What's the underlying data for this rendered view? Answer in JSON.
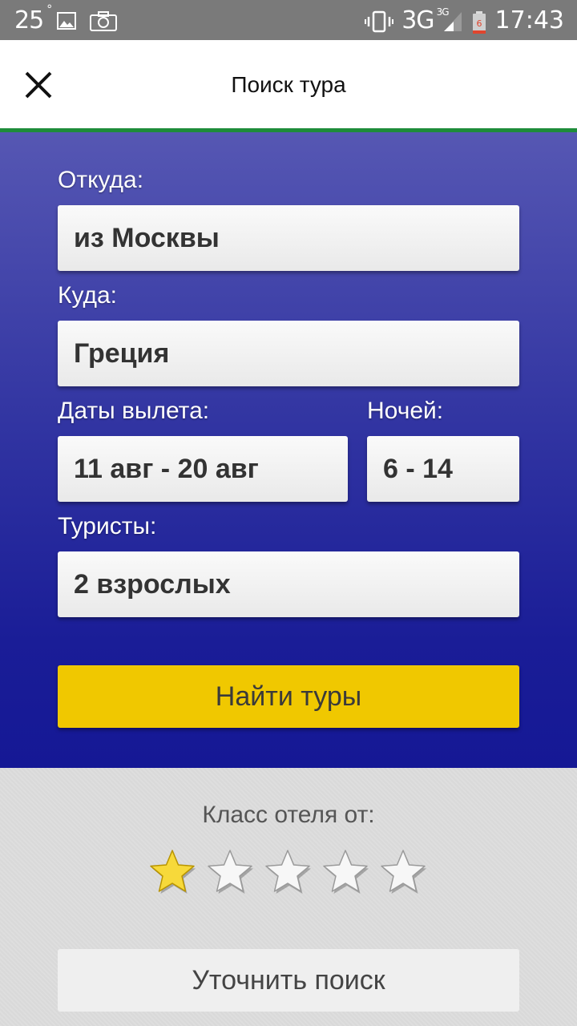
{
  "status_bar": {
    "temperature": "25",
    "degree": "°",
    "network": "3G",
    "network_sup": "3G",
    "battery_level": "6",
    "time": "17:43"
  },
  "appbar": {
    "title": "Поиск тура"
  },
  "form": {
    "from_label": "Откуда:",
    "from_value": "из Москвы",
    "to_label": "Куда:",
    "to_value": "Греция",
    "dates_label": "Даты вылета:",
    "dates_value": "11 авг - 20 авг",
    "nights_label": "Ночей:",
    "nights_value": "6 - 14",
    "tourists_label": "Туристы:",
    "tourists_value": "2 взрослых",
    "search_button": "Найти туры"
  },
  "filters": {
    "hotel_class_label": "Класс отеля от:",
    "stars_total": 5,
    "stars_selected": 1,
    "refine_button": "Уточнить поиск"
  },
  "colors": {
    "accent_yellow": "#f0c800",
    "panel_top": "#5657b3",
    "panel_bottom": "#151895",
    "appbar_underline": "#1e8c3a"
  }
}
